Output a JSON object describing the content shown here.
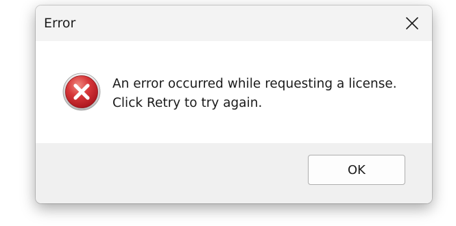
{
  "window": {
    "title": "Error"
  },
  "dialog": {
    "icon": "error-icon",
    "message_line1": "An error occurred while requesting a license.",
    "message_line2": "Click Retry to try again."
  },
  "buttons": {
    "ok_label": "OK"
  },
  "colors": {
    "error_red": "#c8262c",
    "content_bg": "#ffffff",
    "footer_bg": "#f0f0f0"
  }
}
